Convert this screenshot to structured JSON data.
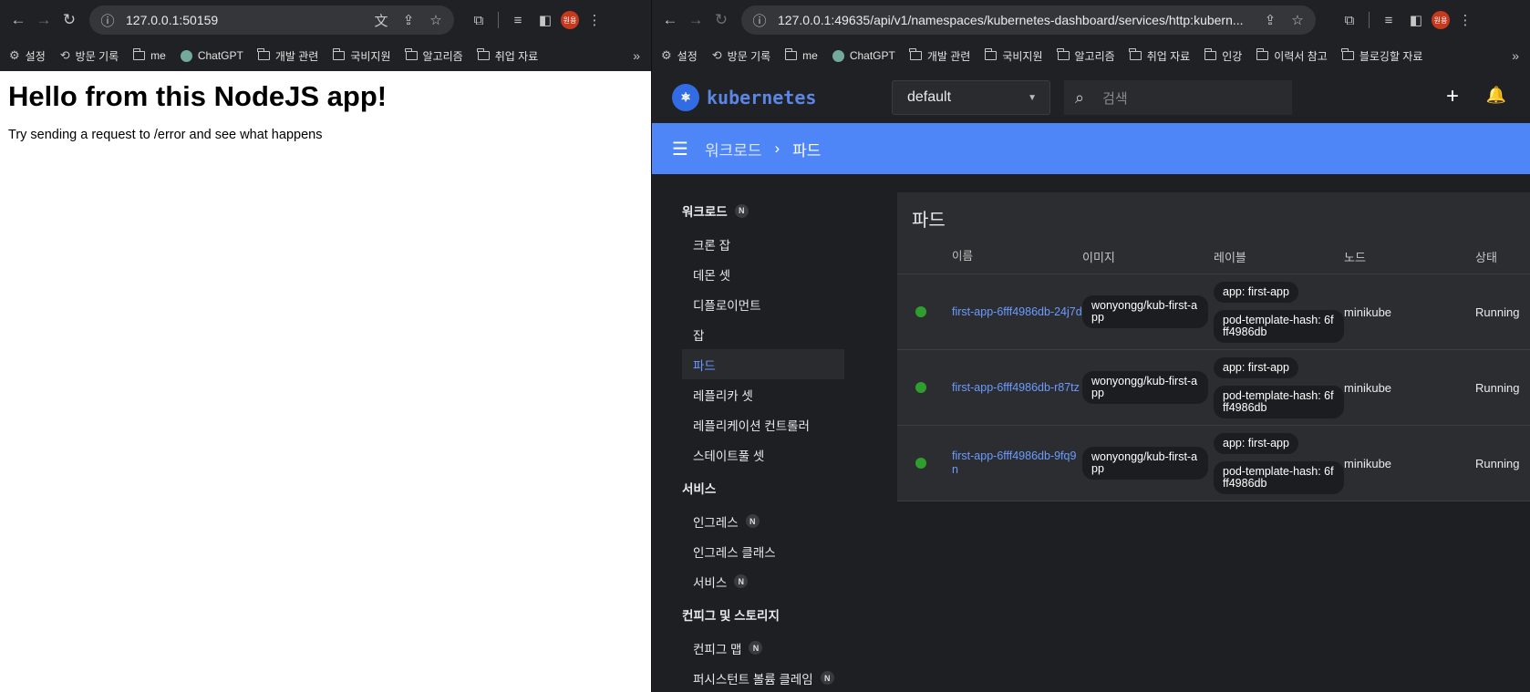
{
  "left": {
    "url": "127.0.0.1:50159",
    "bookmarks": [
      "설정",
      "방문 기록",
      "me",
      "ChatGPT",
      "개발 관련",
      "국비지원",
      "알고리즘",
      "취업 자료"
    ],
    "heading": "Hello from this NodeJS app!",
    "paragraph": "Try sending a request to /error and see what happens"
  },
  "right": {
    "url": "127.0.0.1:49635/api/v1/namespaces/kubernetes-dashboard/services/http:kubern...",
    "bookmarks": [
      "설정",
      "방문 기록",
      "me",
      "ChatGPT",
      "개발 관련",
      "국비지원",
      "알고리즘",
      "취업 자료",
      "인강",
      "이력서 참고",
      "블로깅할 자료"
    ],
    "profile_label": "원용"
  },
  "k8s": {
    "brand": "kubernetes",
    "namespace": "default",
    "search_placeholder": "검색",
    "breadcrumb": {
      "parent": "워크로드",
      "sep": "›",
      "current": "파드"
    },
    "nav": {
      "workloads": "워크로드",
      "workload_items": [
        "크론 잡",
        "데몬 셋",
        "디플로이먼트",
        "잡",
        "파드",
        "레플리카 셋",
        "레플리케이션 컨트롤러",
        "스테이트풀 셋"
      ],
      "services": "서비스",
      "service_items": [
        "인그레스",
        "인그레스 클래스",
        "서비스"
      ],
      "config": "컨피그 및 스토리지",
      "config_items": [
        "컨피그 맵",
        "퍼시스턴트 볼륨 클레임"
      ],
      "badge": "N"
    },
    "card_title": "파드",
    "columns": [
      "이름",
      "이미지",
      "레이블",
      "노드",
      "상태"
    ],
    "rows": [
      {
        "name": "first-app-6fff4986db-24j7d",
        "image": "wonyongg/kub-first-app",
        "label1": "app: first-app",
        "label2": "pod-template-hash: 6fff4986db",
        "node": "minikube",
        "status": "Running"
      },
      {
        "name": "first-app-6fff4986db-r87tz",
        "image": "wonyongg/kub-first-app",
        "label1": "app: first-app",
        "label2": "pod-template-hash: 6fff4986db",
        "node": "minikube",
        "status": "Running"
      },
      {
        "name": "first-app-6fff4986db-9fq9n",
        "image": "wonyongg/kub-first-app",
        "label1": "app: first-app",
        "label2": "pod-template-hash: 6fff4986db",
        "node": "minikube",
        "status": "Running"
      }
    ],
    "status_color": "#2f9e2f",
    "accent": "#4f86f7"
  }
}
